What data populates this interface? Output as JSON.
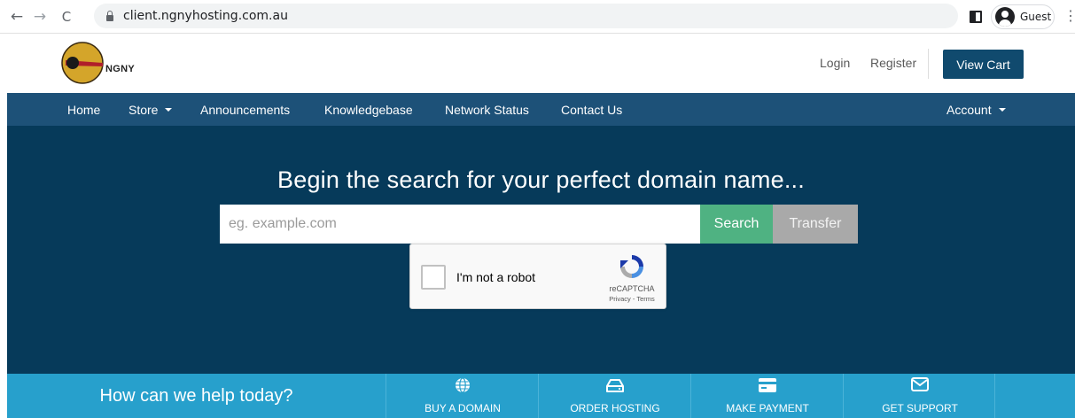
{
  "browser": {
    "url": "client.ngnyhosting.com.au",
    "profile_name": "Guest",
    "back_glyph": "←",
    "forward_glyph": "→",
    "reload_glyph": "C",
    "menu_glyph": "⋮"
  },
  "header": {
    "logo_text": "NGNY",
    "login_label": "Login",
    "register_label": "Register",
    "view_cart_label": "View Cart"
  },
  "nav": {
    "items": [
      {
        "label": "Home"
      },
      {
        "label": "Store"
      },
      {
        "label": "Announcements"
      },
      {
        "label": "Knowledgebase"
      },
      {
        "label": "Network Status"
      },
      {
        "label": "Contact Us"
      }
    ],
    "account_label": "Account"
  },
  "hero": {
    "title": "Begin the search for your perfect domain name...",
    "search_placeholder": "eg. example.com",
    "search_value": "",
    "search_button": "Search",
    "transfer_button": "Transfer"
  },
  "recaptcha": {
    "label": "I'm not a robot",
    "brand": "reCAPTCHA",
    "terms": "Privacy - Terms"
  },
  "help": {
    "title": "How can we help today?",
    "items": [
      {
        "label": "BUY A DOMAIN",
        "icon": "globe-icon"
      },
      {
        "label": "ORDER HOSTING",
        "icon": "hard-drive-icon"
      },
      {
        "label": "MAKE PAYMENT",
        "icon": "credit-card-icon"
      },
      {
        "label": "GET SUPPORT",
        "icon": "envelope-icon"
      }
    ]
  },
  "colors": {
    "header_button": "#104a6e",
    "nav_bar": "#1d5178",
    "hero_bg": "#063a5a",
    "search_button": "#4fb282",
    "transfer_button": "#a9a9a9",
    "help_strip": "#27a0cc"
  }
}
